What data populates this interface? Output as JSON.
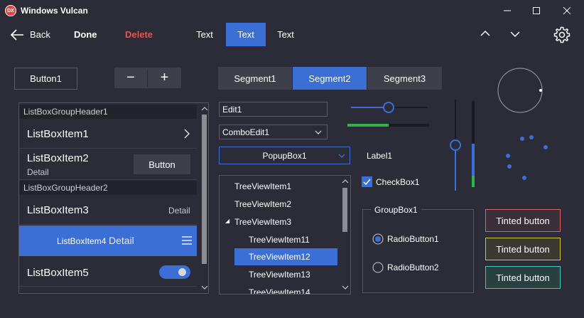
{
  "window": {
    "title": "Windows Vulcan",
    "icon_text": "DX"
  },
  "toolbar": {
    "back_label": "Back",
    "done_label": "Done",
    "delete_label": "Delete"
  },
  "tabs": [
    {
      "label": "Text"
    },
    {
      "label": "Text"
    },
    {
      "label": "Text"
    }
  ],
  "buttons": {
    "button1": "Button1",
    "minus": "−",
    "plus": "+"
  },
  "segments": [
    {
      "label": "Segment1"
    },
    {
      "label": "Segment2"
    },
    {
      "label": "Segment3"
    }
  ],
  "listbox": {
    "header1": "ListBoxGroupHeader1",
    "header2": "ListBoxGroupHeader2",
    "items": [
      {
        "label": "ListBoxItem1"
      },
      {
        "label": "ListBoxItem2",
        "detail": "Detail",
        "button": "Button"
      },
      {
        "label": "ListBoxItem3",
        "detail": "Detail"
      },
      {
        "label": "ListBoxItem4",
        "detail": "Detail"
      },
      {
        "label": "ListBoxItem5"
      }
    ]
  },
  "edit1": "Edit1",
  "combo": "ComboEdit1",
  "popup": "PopupBox1",
  "tree": [
    {
      "label": "TreeViewItem1"
    },
    {
      "label": "TreeViewItem2"
    },
    {
      "label": "TreeViewItem3",
      "expander": "◢"
    },
    {
      "label": "TreeViewItem11"
    },
    {
      "label": "TreeViewItem12"
    },
    {
      "label": "TreeViewItem13"
    },
    {
      "label": "TreeViewItem14"
    }
  ],
  "label1": "Label1",
  "checkbox": {
    "label": "CheckBox1",
    "checked": true
  },
  "groupbox": {
    "title": "GroupBox1",
    "radio1": "RadioButton1",
    "radio2": "RadioButton2"
  },
  "tinted": [
    {
      "label": "Tinted button",
      "color": "#e0605f"
    },
    {
      "label": "Tinted button",
      "color": "#d6c23a"
    },
    {
      "label": "Tinted button",
      "color": "#36c8bb"
    }
  ],
  "colors": {
    "accent": "#3b6fd6",
    "green": "#2fb34a",
    "danger": "#e8534f"
  }
}
